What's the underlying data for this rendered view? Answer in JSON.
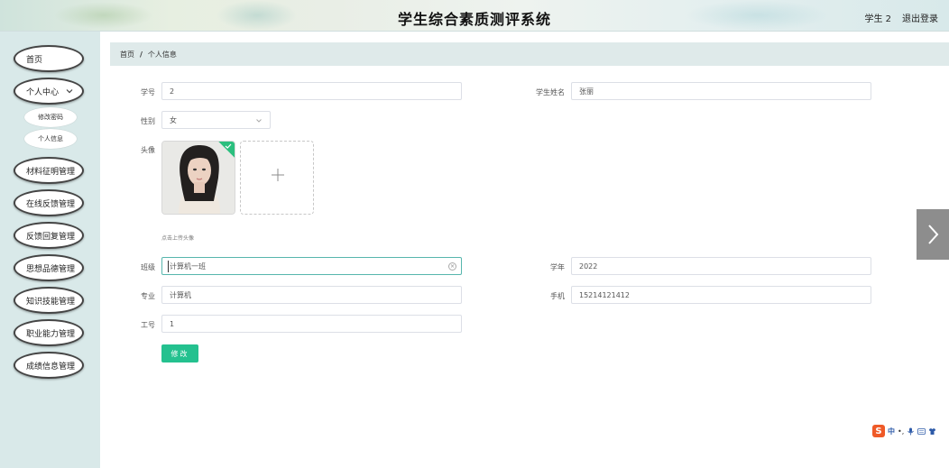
{
  "header": {
    "title": "学生综合素质测评系统",
    "user": "学生 2",
    "logout": "退出登录"
  },
  "sidebar": {
    "items": [
      {
        "label": "首页"
      },
      {
        "label": "个人中心"
      },
      {
        "label": "材料征明管理"
      },
      {
        "label": "在线反馈管理"
      },
      {
        "label": "反馈回复管理"
      },
      {
        "label": "思想品德管理"
      },
      {
        "label": "知识技能管理"
      },
      {
        "label": "职业能力管理"
      },
      {
        "label": "成绩信息管理"
      }
    ],
    "sub_items": [
      {
        "label": "修改密码"
      },
      {
        "label": "个人信息"
      }
    ]
  },
  "breadcrumb": {
    "home": "首页",
    "separator": "/",
    "current": "个人信息"
  },
  "form": {
    "student_no": {
      "label": "学号",
      "value": "2"
    },
    "student_name": {
      "label": "学生姓名",
      "value": "张丽"
    },
    "gender": {
      "label": "性别",
      "value": "女"
    },
    "avatar": {
      "label": "头像",
      "hint": "点击上传头像"
    },
    "class": {
      "label": "班级",
      "value": "计算机一班"
    },
    "year": {
      "label": "学年",
      "value": "2022"
    },
    "major": {
      "label": "专业",
      "value": "计算机"
    },
    "phone": {
      "label": "手机",
      "value": "15214121412"
    },
    "work_no": {
      "label": "工号",
      "value": "1"
    },
    "submit_label": "修改"
  },
  "ime": {
    "logo": "S",
    "mode": "中",
    "punct": "•,"
  },
  "colors": {
    "accent": "#24c18f",
    "sidebar_bg": "#d9e9e9",
    "breadcrumb_bg": "#dfeaea"
  }
}
